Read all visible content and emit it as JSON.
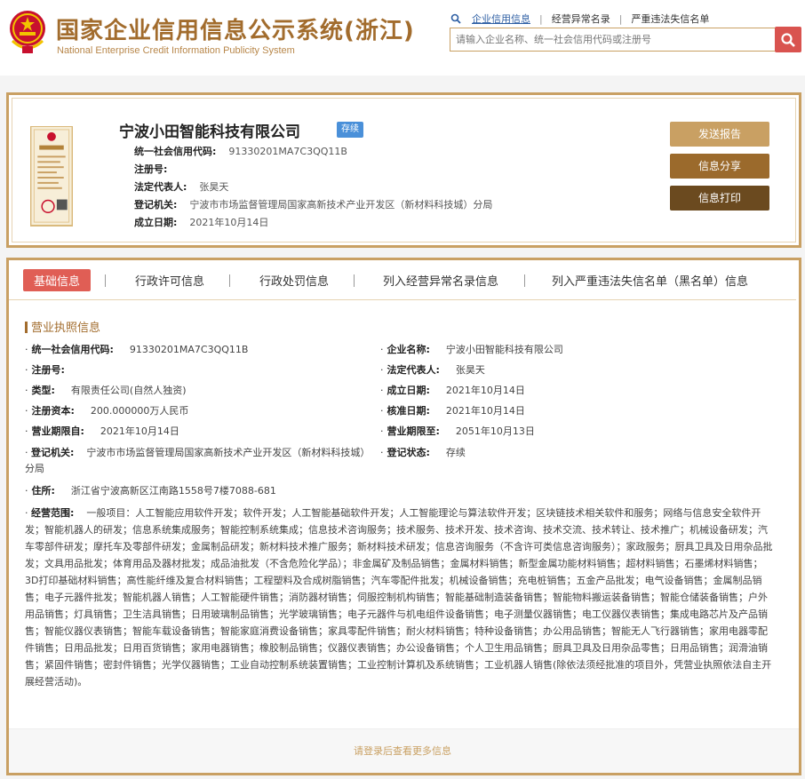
{
  "header": {
    "title": "国家企业信用信息公示系统(浙江)",
    "subtitle": "National Enterprise Credit Information Publicity System",
    "links": [
      "企业信用信息",
      "经营异常名录",
      "严重违法失信名单"
    ],
    "search_placeholder": "请输入企业名称、统一社会信用代码或注册号",
    "search_icon": "search-icon"
  },
  "company": {
    "name": "宁波小田智能科技有限公司",
    "status": "存续",
    "fields": [
      {
        "label": "统一社会信用代码:",
        "value": "91330201MA7C3QQ11B"
      },
      {
        "label": "注册号:",
        "value": ""
      },
      {
        "label": "法定代表人:",
        "value": "张昊天"
      },
      {
        "label": "登记机关:",
        "value": "宁波市市场监督管理局国家高新技术产业开发区（新材料科技城）分局"
      },
      {
        "label": "成立日期:",
        "value": "2021年10月14日"
      }
    ],
    "buttons": {
      "report": "发送报告",
      "share": "信息分享",
      "print": "信息打印"
    }
  },
  "tabs": [
    "基础信息",
    "行政许可信息",
    "行政处罚信息",
    "列入经营异常名录信息",
    "列入严重违法失信名单（黑名单）信息"
  ],
  "section": {
    "title": "营业执照信息",
    "left": [
      {
        "label": "统一社会信用代码:",
        "value": "91330201MA7C3QQ11B"
      },
      {
        "label": "注册号:",
        "value": ""
      },
      {
        "label": "类型:",
        "value": "有限责任公司(自然人独资)"
      },
      {
        "label": "注册资本:",
        "value": "200.000000万人民币"
      },
      {
        "label": "营业期限自:",
        "value": "2021年10月14日"
      }
    ],
    "right": [
      {
        "label": "企业名称:",
        "value": "宁波小田智能科技有限公司"
      },
      {
        "label": "法定代表人:",
        "value": "张昊天"
      },
      {
        "label": "成立日期:",
        "value": "2021年10月14日"
      },
      {
        "label": "核准日期:",
        "value": "2021年10月14日"
      },
      {
        "label": "营业期限至:",
        "value": "2051年10月13日"
      }
    ],
    "authority_label": "登记机关:",
    "authority_value": "宁波市市场监督管理局国家高新技术产业开发区（新材料科技城）分局",
    "status_label": "登记状态:",
    "status_value": "存续",
    "address_label": "住所:",
    "address_value": "浙江省宁波高新区江南路1558号7楼7088-681",
    "scope_label": "经营范围:",
    "scope_value": "一般项目：人工智能应用软件开发；软件开发；人工智能基础软件开发；人工智能理论与算法软件开发；区块链技术相关软件和服务；网络与信息安全软件开发；智能机器人的研发；信息系统集成服务；智能控制系统集成；信息技术咨询服务；技术服务、技术开发、技术咨询、技术交流、技术转让、技术推广；机械设备研发；汽车零部件研发；摩托车及零部件研发；金属制品研发；新材料技术推广服务；新材料技术研发；信息咨询服务（不含许可类信息咨询服务）；家政服务；厨具卫具及日用杂品批发；文具用品批发；体育用品及器材批发；成品油批发（不含危险化学品）；非金属矿及制品销售；金属材料销售；新型金属功能材料销售；超材料销售；石墨烯材料销售；3D打印基础材料销售；高性能纤维及复合材料销售；工程塑料及合成树脂销售；汽车零配件批发；机械设备销售；充电桩销售；五金产品批发；电气设备销售；金属制品销售；电子元器件批发；智能机器人销售；人工智能硬件销售；消防器材销售；伺服控制机构销售；智能基础制造装备销售；智能物料搬运装备销售；智能仓储装备销售；户外用品销售；灯具销售；卫生洁具销售；日用玻璃制品销售；光学玻璃销售；电子元器件与机电组件设备销售；电子测量仪器销售；电工仪器仪表销售；集成电路芯片及产品销售；智能仪器仪表销售；智能车载设备销售；智能家庭消费设备销售；家具零配件销售；耐火材料销售；特种设备销售；办公用品销售；智能无人飞行器销售；家用电器零配件销售；日用品批发；日用百货销售；家用电器销售；橡胶制品销售；仪器仪表销售；办公设备销售；个人卫生用品销售；厨具卫具及日用杂品零售；日用品销售；润滑油销售；紧固件销售；密封件销售；光学仪器销售；工业自动控制系统装置销售；工业控制计算机及系统销售；工业机器人销售(除依法须经批准的项目外，凭营业执照依法自主开展经营活动)。"
  },
  "footer": {
    "more_text": "请登录后查看更多信息"
  }
}
